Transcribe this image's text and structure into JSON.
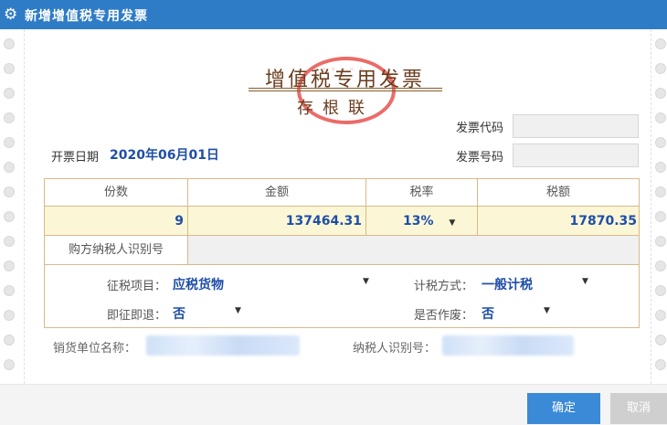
{
  "window": {
    "title": "新增增值税专用发票"
  },
  "invoice": {
    "title": "增值税专用发票",
    "subtitle": "存根联",
    "date_label": "开票日期",
    "date_value": "2020年06月01日",
    "code_label": "发票代码",
    "code_value": "",
    "number_label": "发票号码",
    "number_value": ""
  },
  "table": {
    "headers": [
      "份数",
      "金额",
      "税率",
      "税额"
    ],
    "quantity": "9",
    "amount": "137464.31",
    "rate": "13%",
    "tax": "17870.35",
    "buyer_label": "购方纳税人识别号",
    "buyer_value": ""
  },
  "options": {
    "item_label": "征税项目：",
    "item_value": "应税货物",
    "method_label": "计税方式：",
    "method_value": "一般计税",
    "refund_label": "即征即退：",
    "refund_value": "否",
    "void_label": "是否作废：",
    "void_value": "否"
  },
  "seller": {
    "name_label": "销货单位名称：",
    "taxid_label": "纳税人识别号："
  },
  "buttons": {
    "ok": "确定",
    "cancel": "取消"
  },
  "colors": {
    "titlebar": "#2f7cc6",
    "value_blue": "#1f4ea8",
    "stamp_red": "#e53935",
    "accent_button": "#3b8ad8"
  },
  "icons": {
    "title": "gear-icon",
    "dropdown": "caret-down-icon"
  }
}
